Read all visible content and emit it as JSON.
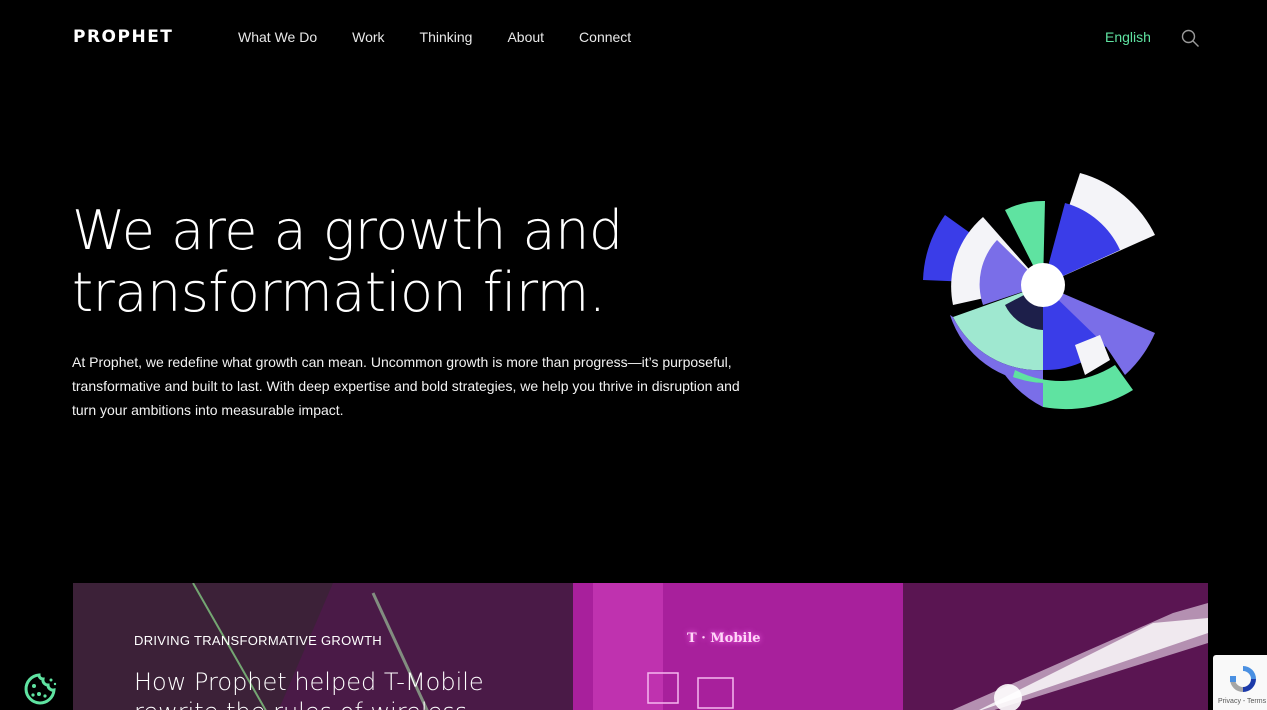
{
  "header": {
    "logo": "PROPHET",
    "nav": [
      {
        "label": "What We Do"
      },
      {
        "label": "Work"
      },
      {
        "label": "Thinking"
      },
      {
        "label": "About"
      },
      {
        "label": "Connect"
      }
    ],
    "language": "English",
    "search_icon": "search-icon"
  },
  "hero": {
    "title_line1": "We are a growth and",
    "title_line2": "transformation firm.",
    "body": "At Prophet, we redefine what growth can mean. Uncommon growth is more than progress—it’s purposeful, transformative and built to last. With deep expertise and bold strategies, we help you thrive in disruption and turn your ambitions into measurable impact.",
    "graphic": "radial-burst-graphic"
  },
  "feature": {
    "eyebrow": "DRIVING TRANSFORMATIVE GROWTH",
    "title": "How Prophet helped T-Mobile rewrite the rules of wireless",
    "sign_text": "T · Mobile"
  },
  "cookie": {
    "icon": "cookie-icon"
  },
  "recaptcha": {
    "text": "Privacy - Terms",
    "icon": "recaptcha-icon"
  },
  "colors": {
    "background": "#000000",
    "accent_green": "#5fe3a1",
    "royal_blue": "#3a3de8",
    "lavender": "#7a6ee8",
    "mint": "#9fe8d0",
    "magenta": "#9a1e8f"
  }
}
